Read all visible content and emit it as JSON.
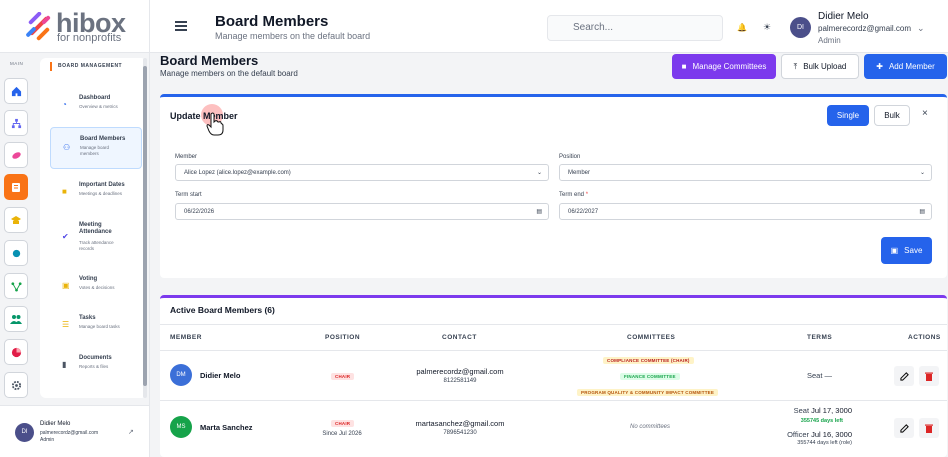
{
  "brand": {
    "name": "hibox",
    "tagline": "for nonprofits"
  },
  "header": {
    "title": "Board Members",
    "subtitle": "Manage members on the default board",
    "search_placeholder": "Search...",
    "user": {
      "initials": "DI",
      "name": "Didier Melo",
      "email": "palmerecordz@gmail.com",
      "role": "Admin"
    }
  },
  "rail": {
    "label": "MAIN",
    "icons": [
      "home-icon",
      "org-chart-icon",
      "handshake-icon",
      "board-icon",
      "graduation-icon",
      "circle-icon",
      "flow-icon",
      "users-icon",
      "pie-chart-icon",
      "gear-icon"
    ]
  },
  "sidebar": {
    "heading": "BOARD MANAGEMENT",
    "items": [
      {
        "title": "Dashboard",
        "desc": "Overview & metrics"
      },
      {
        "title": "Board Members",
        "desc": "Manage board members"
      },
      {
        "title": "Important Dates",
        "desc": "Meetings & deadlines"
      },
      {
        "title": "Meeting Attendance",
        "desc": "Track attendance records"
      },
      {
        "title": "Voting",
        "desc": "Votes & decisions"
      },
      {
        "title": "Tasks",
        "desc": "Manage board tasks"
      },
      {
        "title": "Documents",
        "desc": "Reports & files"
      }
    ]
  },
  "bottom_user": {
    "initials": "DI",
    "name": "Didier Melo",
    "email": "palmerecordz@gmail.com",
    "role": "Admin"
  },
  "page": {
    "title": "Board Members",
    "subtitle": "Manage members on the default board"
  },
  "actions": {
    "manage_committees": "Manage Committees",
    "bulk_upload": "Bulk Upload",
    "add_member": "Add Member"
  },
  "form": {
    "title": "Update Member",
    "single": "Single",
    "bulk": "Bulk",
    "close": "×",
    "member_label": "Member",
    "member_value": "Alice Lopez (alice.lopez@example.com)",
    "position_label": "Position",
    "position_value": "Member",
    "term_start_label": "Term start",
    "term_start_value": "06/22/2026",
    "term_end_label": "Term end",
    "term_end_required": "*",
    "term_end_value": "06/22/2027",
    "save": "Save"
  },
  "table": {
    "title": "Active Board Members (6)",
    "headers": {
      "member": "MEMBER",
      "position": "POSITION",
      "contact": "CONTACT",
      "committees": "COMMITTEES",
      "terms": "TERMS",
      "actions": "ACTIONS"
    },
    "rows": [
      {
        "initials": "DM",
        "name": "Didier Melo",
        "avatar_color": "#3b6fd8",
        "position": "CHAIR",
        "since": "",
        "email": "palmerecordz@gmail.com",
        "phone": "8122581149",
        "committees": [
          "COMPLIANCE COMMITTEE (CHAIR)",
          "FINANCE COMMITTEE",
          "PROGRAM QUALITY & COMMUNITY IMPACT COMMITTEE"
        ],
        "no_committees": "",
        "terms": {
          "seat": "Seat —"
        }
      },
      {
        "initials": "MS",
        "name": "Marta Sanchez",
        "avatar_color": "#16a34a",
        "position": "CHAIR",
        "since": "Since Jul 2026",
        "email": "martasanchez@gmail.com",
        "phone": "7896541230",
        "committees": [],
        "no_committees": "No committees",
        "terms": {
          "seat_label": "Seat",
          "seat_date": "Jul 17, 3000",
          "seat_left": "355745 days left",
          "officer_label": "Officer",
          "officer_date": "Jul 16, 3000",
          "officer_left": "355744 days left (role)"
        }
      }
    ]
  }
}
